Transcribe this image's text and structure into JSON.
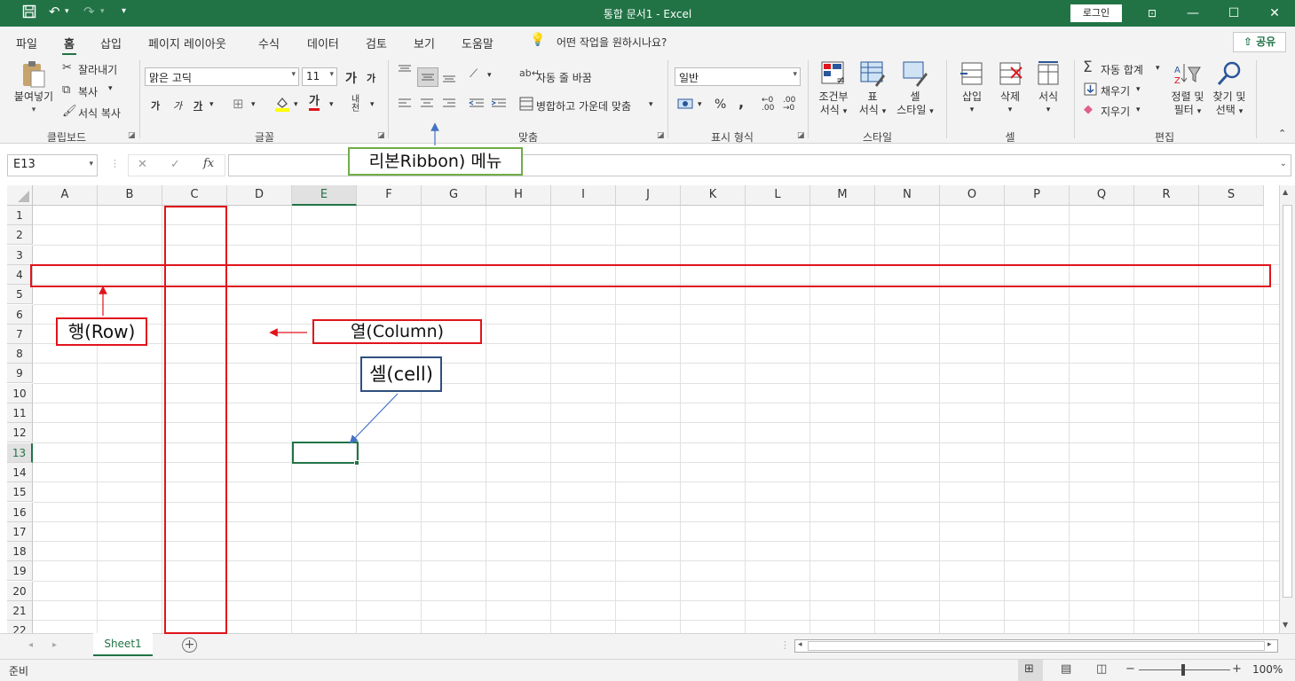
{
  "titlebar": {
    "title": "통합 문서1  -  Excel",
    "login_label": "로그인",
    "icons": [
      "save-icon",
      "undo-icon",
      "redo-icon",
      "customize-icon",
      "ribbon-display-icon",
      "minimize-icon",
      "maximize-icon",
      "close-icon"
    ]
  },
  "menu": {
    "tabs": [
      "파일",
      "홈",
      "삽입",
      "페이지 레이아웃",
      "수식",
      "데이터",
      "검토",
      "보기",
      "도움말"
    ],
    "active_tab": "홈",
    "tell_me": "어떤 작업을 원하시나요?",
    "share_label": "공유"
  },
  "ribbon": {
    "clipboard": {
      "paste": "붙여넣기",
      "cut": "잘라내기",
      "copy": "복사",
      "format_painter": "서식 복사",
      "group": "클립보드"
    },
    "font": {
      "name": "맑은 고딕",
      "size": "11",
      "grow": "가",
      "shrink": "가",
      "bold": "가",
      "italic": "가",
      "underline": "가",
      "color_char": "가",
      "phonetic": "내천",
      "group": "글꼴"
    },
    "alignment": {
      "wrap": "자동 줄 바꿈",
      "merge": "병합하고 가운데 맞춤",
      "group": "맞춤"
    },
    "number": {
      "format": "일반",
      "percent": "%",
      "comma": ",",
      "group": "표시 형식"
    },
    "styles": {
      "conditional": [
        "조건부",
        "서식"
      ],
      "table": [
        "표",
        "서식"
      ],
      "cell": [
        "셀",
        "스타일"
      ],
      "group": "스타일"
    },
    "cells": {
      "insert": "삽입",
      "delete": "삭제",
      "format": "서식",
      "group": "셀"
    },
    "editing": {
      "autosum": "자동 합계",
      "fill": "채우기",
      "clear": "지우기",
      "sort": [
        "정렬 및",
        "필터"
      ],
      "find": [
        "찾기 및",
        "선택"
      ],
      "group": "편집"
    }
  },
  "formula_bar": {
    "name_box": "E13",
    "cancel": "✕",
    "enter": "✓",
    "fx": "fx",
    "value": ""
  },
  "grid": {
    "columns": [
      "A",
      "B",
      "C",
      "D",
      "E",
      "F",
      "G",
      "H",
      "I",
      "J",
      "K",
      "L",
      "M",
      "N",
      "O",
      "P",
      "Q",
      "R",
      "S"
    ],
    "rows": [
      "1",
      "2",
      "3",
      "4",
      "5",
      "6",
      "7",
      "8",
      "9",
      "10",
      "11",
      "12",
      "13",
      "14",
      "15",
      "16",
      "17",
      "18",
      "19",
      "20",
      "21",
      "22"
    ],
    "selected_column": "E",
    "selected_row": "13"
  },
  "sheets": {
    "tabs": [
      "Sheet1"
    ],
    "active": "Sheet1"
  },
  "status": {
    "mode": "준비",
    "zoom": "100%"
  },
  "annotations": {
    "ribbon": "리본Ribbon) 메뉴",
    "row": "행(Row)",
    "column": "열(Column)",
    "cell": "셀(cell)",
    "colors": {
      "highlight": "#e0141b",
      "ribbon_label": "#70ad47",
      "cell_label": "#2f4f7f",
      "arrow": "#4472c4"
    }
  },
  "colors": {
    "excel_green": "#217346",
    "ribbon_bg": "#f3f3f3"
  }
}
